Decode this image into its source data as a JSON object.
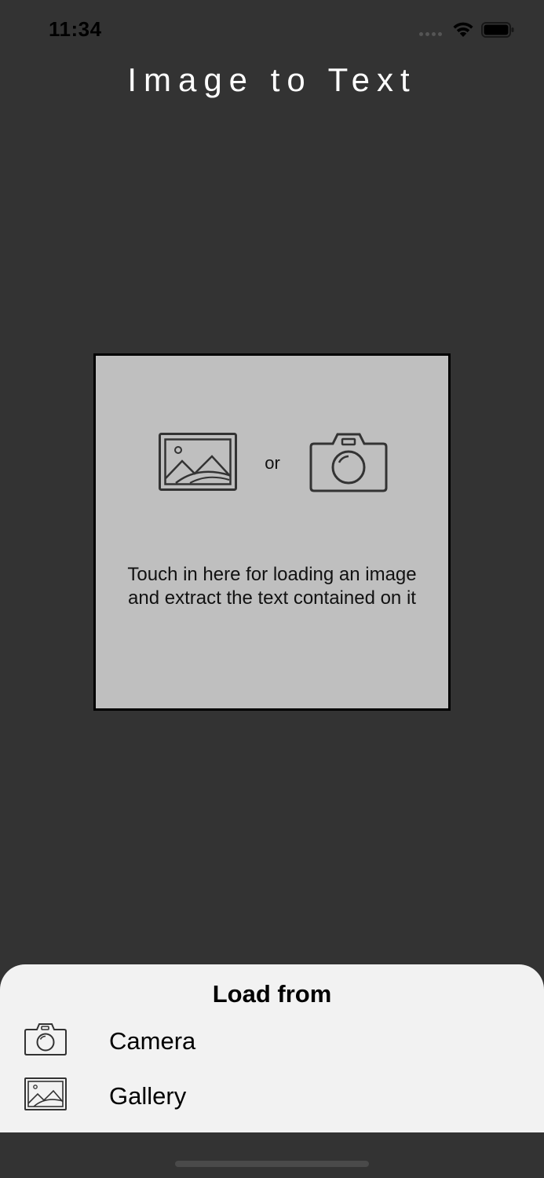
{
  "status_bar": {
    "time": "11:34"
  },
  "app": {
    "title": "Image to Text"
  },
  "drop_zone": {
    "or_label": "or",
    "hint": "Touch in here for loading an image and extract the text contained on it"
  },
  "sheet": {
    "title": "Load from",
    "options": [
      {
        "label": "Camera",
        "icon": "camera-icon"
      },
      {
        "label": "Gallery",
        "icon": "gallery-icon"
      }
    ]
  },
  "colors": {
    "background": "#333333",
    "drop_zone": "#bfbfbf",
    "sheet": "#f2f2f2",
    "title_text": "#ffffff"
  }
}
